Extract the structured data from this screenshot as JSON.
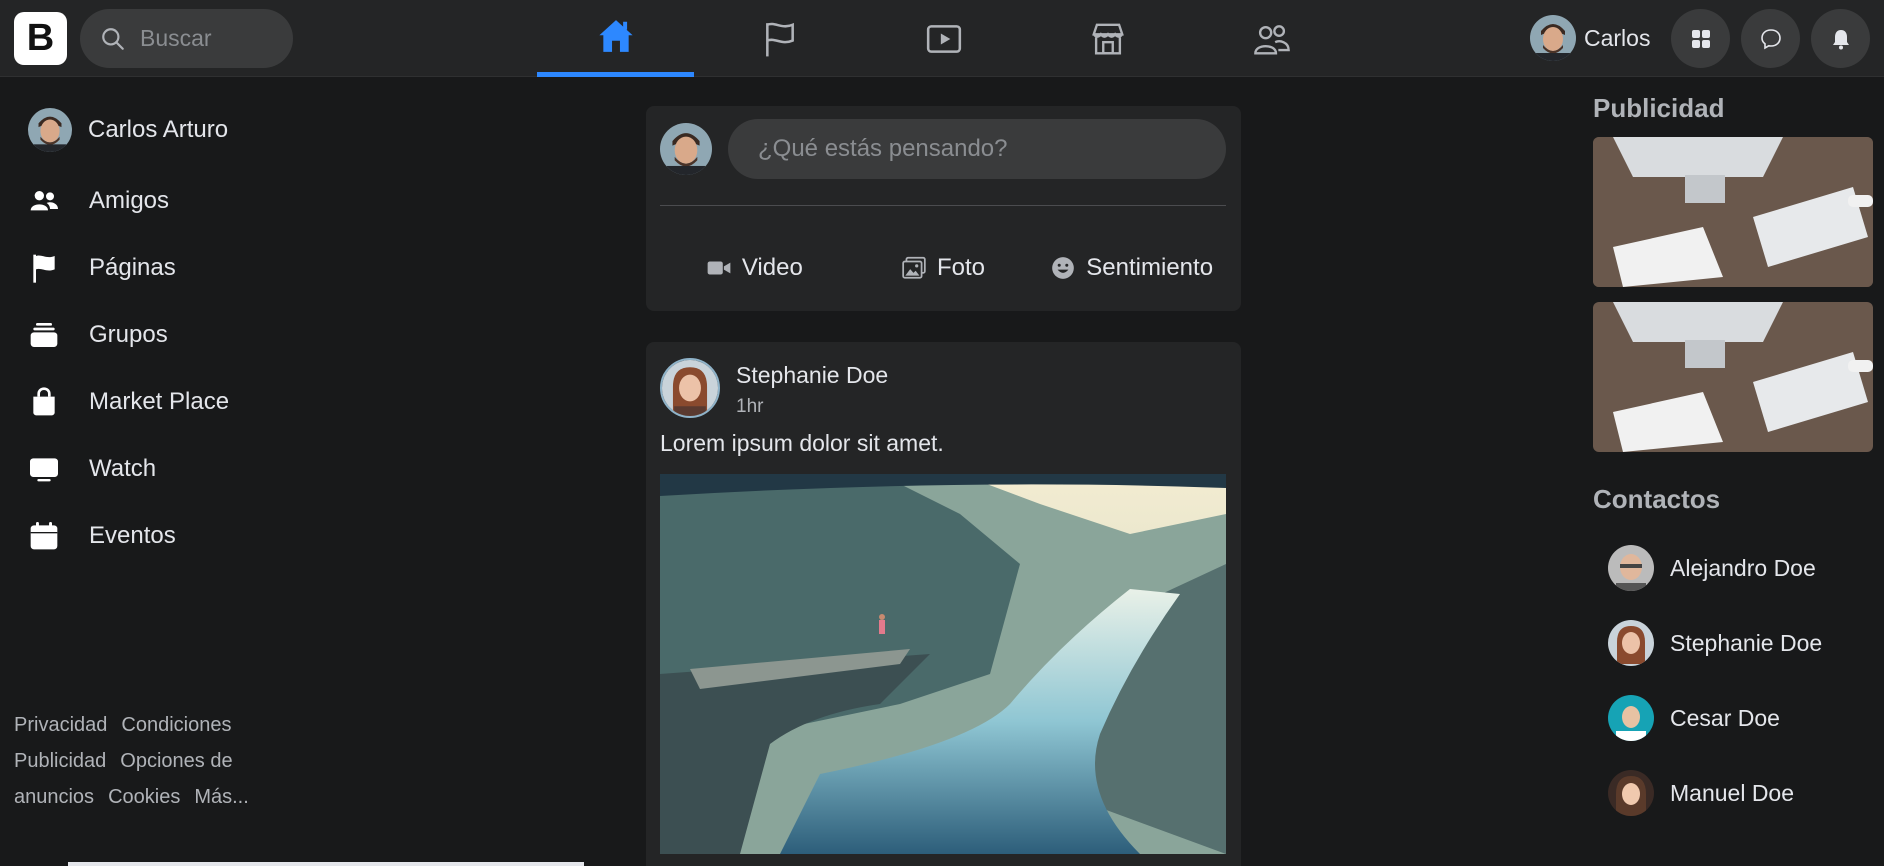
{
  "header": {
    "logo_letter": "B",
    "search_placeholder": "Buscar",
    "nav_tabs": [
      {
        "name": "home",
        "icon": "home-icon",
        "active": true
      },
      {
        "name": "pages",
        "icon": "flag-icon",
        "active": false
      },
      {
        "name": "watch",
        "icon": "video-play-icon",
        "active": false
      },
      {
        "name": "marketplace",
        "icon": "store-icon",
        "active": false
      },
      {
        "name": "groups",
        "icon": "people-icon",
        "active": false
      }
    ],
    "profile_name": "Carlos",
    "right_buttons": [
      "grid-menu-icon",
      "messenger-icon",
      "bell-icon"
    ],
    "accent_color": "#2d88ff"
  },
  "left_sidebar": {
    "profile_name": "Carlos Arturo",
    "items": [
      {
        "label": "Amigos",
        "icon": "friends-icon"
      },
      {
        "label": "Páginas",
        "icon": "flag-icon"
      },
      {
        "label": "Grupos",
        "icon": "groups-icon"
      },
      {
        "label": "Market Place",
        "icon": "shopping-bag-icon"
      },
      {
        "label": "Watch",
        "icon": "tv-icon"
      },
      {
        "label": "Eventos",
        "icon": "calendar-icon"
      }
    ],
    "footer_links": [
      "Privacidad",
      "Condiciones",
      "Publicidad",
      "Opciones de",
      "anuncios",
      "Cookies",
      "Más..."
    ]
  },
  "composer": {
    "placeholder": "¿Qué estás pensando?",
    "actions": [
      {
        "label": "Video",
        "icon": "video-camera-icon"
      },
      {
        "label": "Foto",
        "icon": "image-icon"
      },
      {
        "label": "Sentimiento",
        "icon": "smile-icon"
      }
    ]
  },
  "post": {
    "author": "Stephanie Doe",
    "time": "1hr",
    "text": "Lorem ipsum dolor sit amet."
  },
  "right_sidebar": {
    "ads_title": "Publicidad",
    "contacts_title": "Contactos",
    "contacts": [
      "Alejandro Doe",
      "Stephanie Doe",
      "Cesar Doe",
      "Manuel Doe"
    ]
  }
}
